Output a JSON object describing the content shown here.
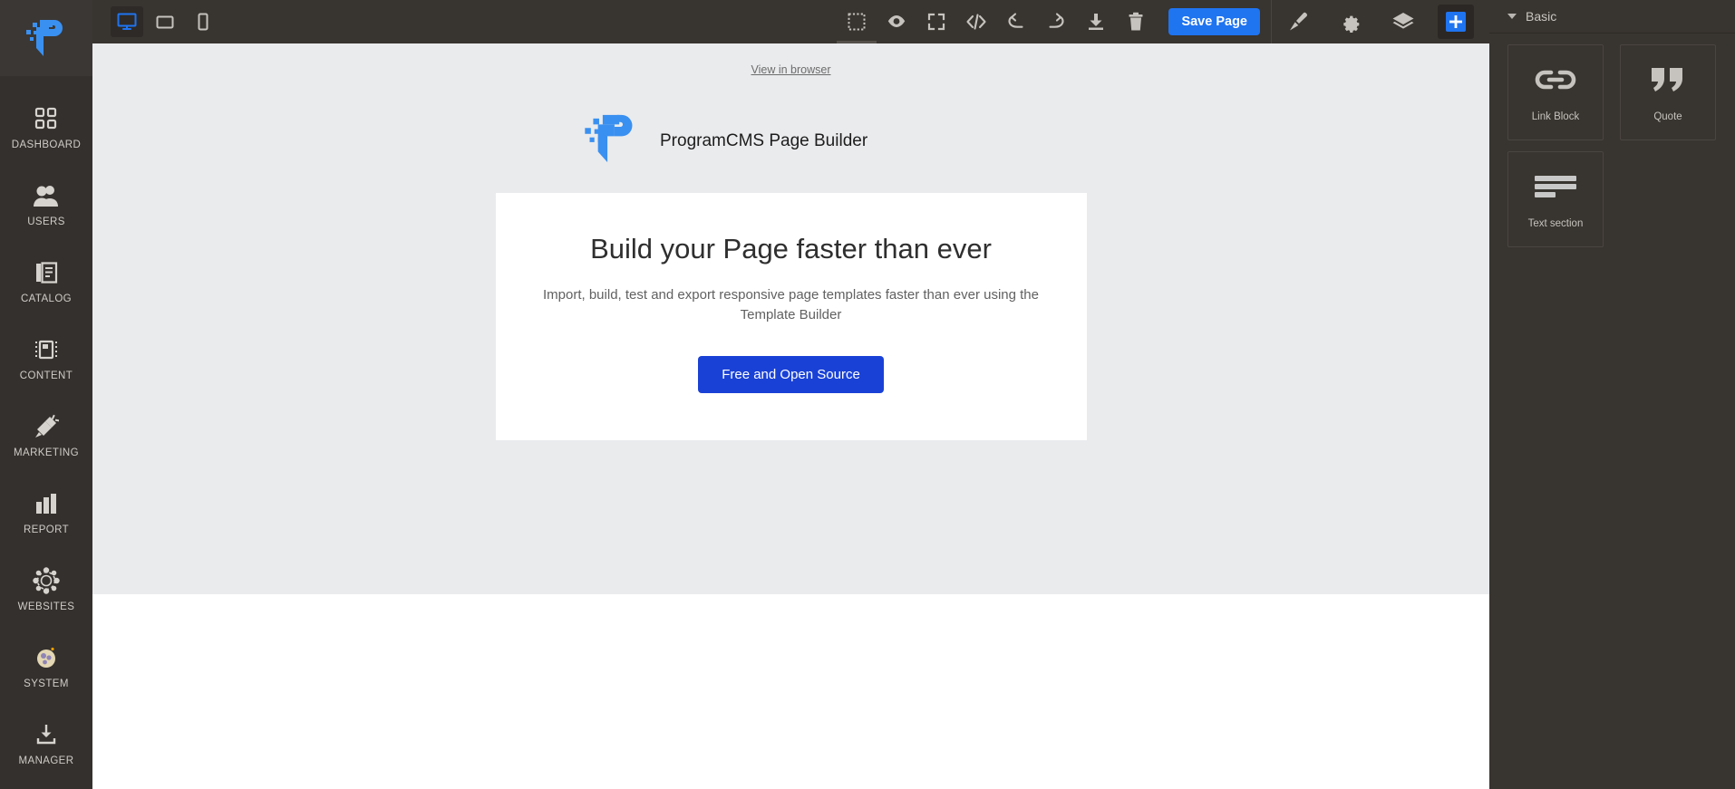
{
  "sidebar": {
    "logo_name": "programcms-logo",
    "items": [
      {
        "label": "DASHBOARD",
        "icon": "dashboard-grid-icon"
      },
      {
        "label": "USERS",
        "icon": "users-icon"
      },
      {
        "label": "CATALOG",
        "icon": "catalog-book-icon"
      },
      {
        "label": "CONTENT",
        "icon": "content-book-icon"
      },
      {
        "label": "MARKETING",
        "icon": "megaphone-icon"
      },
      {
        "label": "REPORT",
        "icon": "bar-chart-icon"
      },
      {
        "label": "WEBSITES",
        "icon": "globe-nodes-icon"
      },
      {
        "label": "SYSTEM",
        "icon": "system-gear-ball-icon"
      },
      {
        "label": "MANAGER",
        "icon": "download-tray-icon"
      }
    ]
  },
  "toolbar": {
    "devices": [
      {
        "name": "desktop",
        "icon": "desktop-icon",
        "active": true
      },
      {
        "name": "tablet",
        "icon": "tablet-icon",
        "active": false
      },
      {
        "name": "mobile",
        "icon": "mobile-icon",
        "active": false
      }
    ],
    "actions": [
      {
        "name": "toggle-borders",
        "icon": "dashed-square-icon",
        "selected": true
      },
      {
        "name": "preview",
        "icon": "eye-icon",
        "selected": false
      },
      {
        "name": "fullscreen",
        "icon": "fullscreen-icon",
        "selected": false
      },
      {
        "name": "view-code",
        "icon": "code-icon",
        "selected": false
      },
      {
        "name": "undo",
        "icon": "undo-icon",
        "selected": false
      },
      {
        "name": "redo",
        "icon": "redo-icon",
        "selected": false
      },
      {
        "name": "import-export",
        "icon": "download-icon",
        "selected": false
      },
      {
        "name": "clear-canvas",
        "icon": "trash-icon",
        "selected": false
      }
    ],
    "save_label": "Save Page",
    "panels": [
      {
        "name": "style-manager",
        "icon": "brush-icon",
        "active": false
      },
      {
        "name": "settings",
        "icon": "gear-icon",
        "active": false
      },
      {
        "name": "layer-manager",
        "icon": "layers-icon",
        "active": false
      },
      {
        "name": "blocks",
        "icon": "plus-icon",
        "active": true
      }
    ],
    "accent_color": "#1f74f0"
  },
  "canvas": {
    "view_in_browser": "View in browser",
    "brand_title": "ProgramCMS Page Builder",
    "hero": {
      "title": "Build your Page faster than ever",
      "subtitle": "Import, build, test and export responsive page templates faster than ever using the Template Builder",
      "cta_label": "Free and Open Source",
      "cta_color": "#1a41d6"
    },
    "background_color": "#eaebed",
    "card_color": "#ffffff"
  },
  "right_panel": {
    "section_title": "Basic",
    "blocks": [
      {
        "label": "Link Block",
        "icon": "link-chain-icon"
      },
      {
        "label": "Quote",
        "icon": "quote-marks-icon"
      },
      {
        "label": "Text section",
        "icon": "text-lines-icon"
      }
    ]
  }
}
